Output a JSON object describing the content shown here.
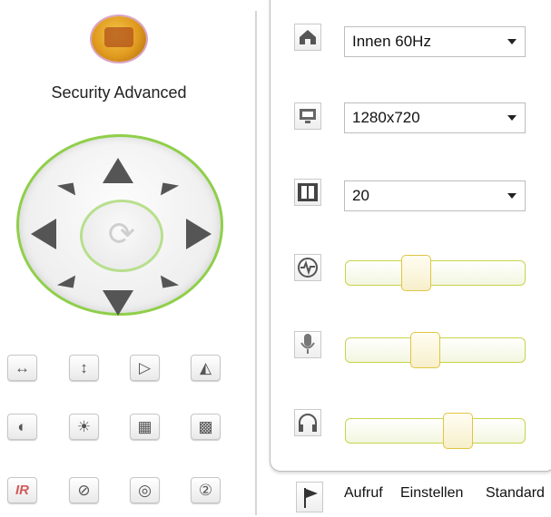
{
  "brand": {
    "name": "Security Advanced"
  },
  "ptz": {
    "home_icon": "rotate-home-icon",
    "arrows": [
      "up",
      "down",
      "left",
      "right",
      "up-left",
      "up-right",
      "down-left",
      "down-right"
    ]
  },
  "toolbar_rows": [
    [
      {
        "name": "flip-horizontal-icon",
        "glyph": "↔"
      },
      {
        "name": "flip-vertical-icon",
        "glyph": "↕"
      },
      {
        "name": "mirror-icon",
        "glyph": "▷"
      },
      {
        "name": "mirror-split-icon",
        "glyph": "◭"
      }
    ],
    [
      {
        "name": "contrast-icon",
        "glyph": "◐"
      },
      {
        "name": "brightness-icon",
        "glyph": "☀"
      },
      {
        "name": "image-icon",
        "glyph": "▦"
      },
      {
        "name": "saturation-icon",
        "glyph": "▩"
      }
    ],
    [
      {
        "name": "ir-icon",
        "glyph": "IR"
      },
      {
        "name": "no-flip-icon",
        "glyph": "⊘"
      },
      {
        "name": "aperture-icon",
        "glyph": "◎"
      },
      {
        "name": "speed-icon",
        "glyph": "②"
      }
    ]
  ],
  "settings": {
    "frequency": {
      "icon": "home-icon",
      "value": "Innen 60Hz"
    },
    "resolution": {
      "icon": "monitor-icon",
      "value": "1280x720"
    },
    "framerate": {
      "icon": "film-icon",
      "value": "20"
    },
    "bitrate": {
      "icon": "signal-icon",
      "level": 0.37
    },
    "microphone": {
      "icon": "microphone-icon",
      "level": 0.43
    },
    "speaker": {
      "icon": "headphones-icon",
      "level": 0.65
    }
  },
  "bottom_bar": {
    "flag_icon": "flag-icon",
    "call": "Aufruf",
    "set": "Einstellen",
    "default": "Standard"
  }
}
